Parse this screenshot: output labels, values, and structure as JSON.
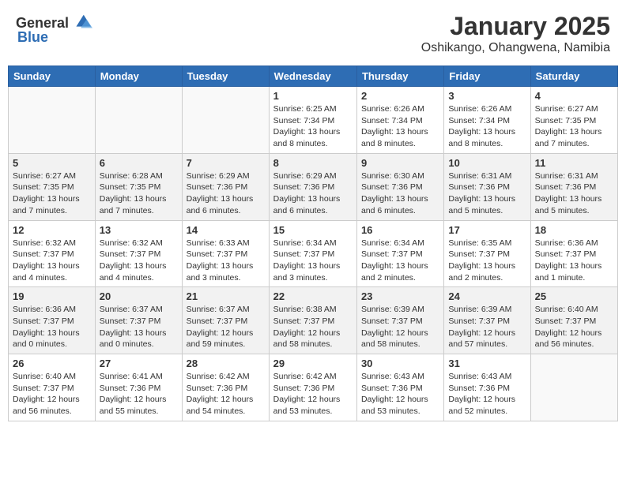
{
  "header": {
    "logo_general": "General",
    "logo_blue": "Blue",
    "month": "January 2025",
    "location": "Oshikango, Ohangwena, Namibia"
  },
  "weekdays": [
    "Sunday",
    "Monday",
    "Tuesday",
    "Wednesday",
    "Thursday",
    "Friday",
    "Saturday"
  ],
  "weeks": [
    [
      {
        "day": "",
        "info": ""
      },
      {
        "day": "",
        "info": ""
      },
      {
        "day": "",
        "info": ""
      },
      {
        "day": "1",
        "info": "Sunrise: 6:25 AM\nSunset: 7:34 PM\nDaylight: 13 hours and 8 minutes."
      },
      {
        "day": "2",
        "info": "Sunrise: 6:26 AM\nSunset: 7:34 PM\nDaylight: 13 hours and 8 minutes."
      },
      {
        "day": "3",
        "info": "Sunrise: 6:26 AM\nSunset: 7:34 PM\nDaylight: 13 hours and 8 minutes."
      },
      {
        "day": "4",
        "info": "Sunrise: 6:27 AM\nSunset: 7:35 PM\nDaylight: 13 hours and 7 minutes."
      }
    ],
    [
      {
        "day": "5",
        "info": "Sunrise: 6:27 AM\nSunset: 7:35 PM\nDaylight: 13 hours and 7 minutes."
      },
      {
        "day": "6",
        "info": "Sunrise: 6:28 AM\nSunset: 7:35 PM\nDaylight: 13 hours and 7 minutes."
      },
      {
        "day": "7",
        "info": "Sunrise: 6:29 AM\nSunset: 7:36 PM\nDaylight: 13 hours and 6 minutes."
      },
      {
        "day": "8",
        "info": "Sunrise: 6:29 AM\nSunset: 7:36 PM\nDaylight: 13 hours and 6 minutes."
      },
      {
        "day": "9",
        "info": "Sunrise: 6:30 AM\nSunset: 7:36 PM\nDaylight: 13 hours and 6 minutes."
      },
      {
        "day": "10",
        "info": "Sunrise: 6:31 AM\nSunset: 7:36 PM\nDaylight: 13 hours and 5 minutes."
      },
      {
        "day": "11",
        "info": "Sunrise: 6:31 AM\nSunset: 7:36 PM\nDaylight: 13 hours and 5 minutes."
      }
    ],
    [
      {
        "day": "12",
        "info": "Sunrise: 6:32 AM\nSunset: 7:37 PM\nDaylight: 13 hours and 4 minutes."
      },
      {
        "day": "13",
        "info": "Sunrise: 6:32 AM\nSunset: 7:37 PM\nDaylight: 13 hours and 4 minutes."
      },
      {
        "day": "14",
        "info": "Sunrise: 6:33 AM\nSunset: 7:37 PM\nDaylight: 13 hours and 3 minutes."
      },
      {
        "day": "15",
        "info": "Sunrise: 6:34 AM\nSunset: 7:37 PM\nDaylight: 13 hours and 3 minutes."
      },
      {
        "day": "16",
        "info": "Sunrise: 6:34 AM\nSunset: 7:37 PM\nDaylight: 13 hours and 2 minutes."
      },
      {
        "day": "17",
        "info": "Sunrise: 6:35 AM\nSunset: 7:37 PM\nDaylight: 13 hours and 2 minutes."
      },
      {
        "day": "18",
        "info": "Sunrise: 6:36 AM\nSunset: 7:37 PM\nDaylight: 13 hours and 1 minute."
      }
    ],
    [
      {
        "day": "19",
        "info": "Sunrise: 6:36 AM\nSunset: 7:37 PM\nDaylight: 13 hours and 0 minutes."
      },
      {
        "day": "20",
        "info": "Sunrise: 6:37 AM\nSunset: 7:37 PM\nDaylight: 13 hours and 0 minutes."
      },
      {
        "day": "21",
        "info": "Sunrise: 6:37 AM\nSunset: 7:37 PM\nDaylight: 12 hours and 59 minutes."
      },
      {
        "day": "22",
        "info": "Sunrise: 6:38 AM\nSunset: 7:37 PM\nDaylight: 12 hours and 58 minutes."
      },
      {
        "day": "23",
        "info": "Sunrise: 6:39 AM\nSunset: 7:37 PM\nDaylight: 12 hours and 58 minutes."
      },
      {
        "day": "24",
        "info": "Sunrise: 6:39 AM\nSunset: 7:37 PM\nDaylight: 12 hours and 57 minutes."
      },
      {
        "day": "25",
        "info": "Sunrise: 6:40 AM\nSunset: 7:37 PM\nDaylight: 12 hours and 56 minutes."
      }
    ],
    [
      {
        "day": "26",
        "info": "Sunrise: 6:40 AM\nSunset: 7:37 PM\nDaylight: 12 hours and 56 minutes."
      },
      {
        "day": "27",
        "info": "Sunrise: 6:41 AM\nSunset: 7:36 PM\nDaylight: 12 hours and 55 minutes."
      },
      {
        "day": "28",
        "info": "Sunrise: 6:42 AM\nSunset: 7:36 PM\nDaylight: 12 hours and 54 minutes."
      },
      {
        "day": "29",
        "info": "Sunrise: 6:42 AM\nSunset: 7:36 PM\nDaylight: 12 hours and 53 minutes."
      },
      {
        "day": "30",
        "info": "Sunrise: 6:43 AM\nSunset: 7:36 PM\nDaylight: 12 hours and 53 minutes."
      },
      {
        "day": "31",
        "info": "Sunrise: 6:43 AM\nSunset: 7:36 PM\nDaylight: 12 hours and 52 minutes."
      },
      {
        "day": "",
        "info": ""
      }
    ]
  ]
}
